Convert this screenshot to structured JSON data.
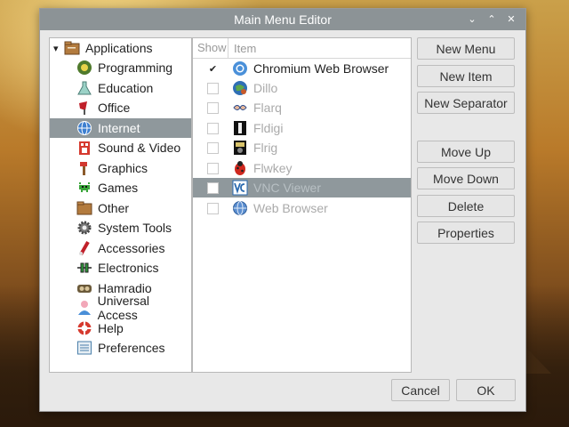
{
  "window": {
    "title": "Main Menu Editor"
  },
  "titlebar": {
    "minimize": "⌄",
    "maximize": "⌃",
    "close": "✕"
  },
  "tree": {
    "root": {
      "label": "Applications",
      "expander": "▾"
    },
    "items": [
      {
        "label": "Programming",
        "icon": "programming-icon",
        "selected": false
      },
      {
        "label": "Education",
        "icon": "education-icon",
        "selected": false
      },
      {
        "label": "Office",
        "icon": "office-icon",
        "selected": false
      },
      {
        "label": "Internet",
        "icon": "internet-icon",
        "selected": true
      },
      {
        "label": "Sound & Video",
        "icon": "sound-video-icon",
        "selected": false
      },
      {
        "label": "Graphics",
        "icon": "graphics-icon",
        "selected": false
      },
      {
        "label": "Games",
        "icon": "games-icon",
        "selected": false
      },
      {
        "label": "Other",
        "icon": "other-icon",
        "selected": false
      },
      {
        "label": "System Tools",
        "icon": "system-tools-icon",
        "selected": false
      },
      {
        "label": "Accessories",
        "icon": "accessories-icon",
        "selected": false
      },
      {
        "label": "Electronics",
        "icon": "electronics-icon",
        "selected": false
      },
      {
        "label": "Hamradio",
        "icon": "hamradio-icon",
        "selected": false
      },
      {
        "label": "Universal Access",
        "icon": "universal-access-icon",
        "selected": false
      },
      {
        "label": "Help",
        "icon": "help-icon",
        "selected": false
      },
      {
        "label": "Preferences",
        "icon": "preferences-icon",
        "selected": false
      }
    ]
  },
  "list": {
    "columns": {
      "show": "Show",
      "item": "Item"
    },
    "rows": [
      {
        "label": "Chromium Web Browser",
        "shown": true,
        "icon": "chromium-icon"
      },
      {
        "label": "Dillo",
        "shown": false,
        "icon": "dillo-icon"
      },
      {
        "label": "Flarq",
        "shown": false,
        "icon": "flarq-icon"
      },
      {
        "label": "Fldigi",
        "shown": false,
        "icon": "fldigi-icon"
      },
      {
        "label": "Flrig",
        "shown": false,
        "icon": "flrig-icon"
      },
      {
        "label": "Flwkey",
        "shown": false,
        "icon": "flwkey-icon"
      },
      {
        "label": "VNC Viewer",
        "shown": false,
        "icon": "vnc-viewer-icon",
        "selected": true
      },
      {
        "label": "Web Browser",
        "shown": false,
        "icon": "web-browser-icon"
      }
    ]
  },
  "buttons": {
    "new_menu": "New Menu",
    "new_item": "New Item",
    "new_separator": "New Separator",
    "move_up": "Move Up",
    "move_down": "Move Down",
    "delete": "Delete",
    "properties": "Properties",
    "cancel": "Cancel",
    "ok": "OK"
  }
}
